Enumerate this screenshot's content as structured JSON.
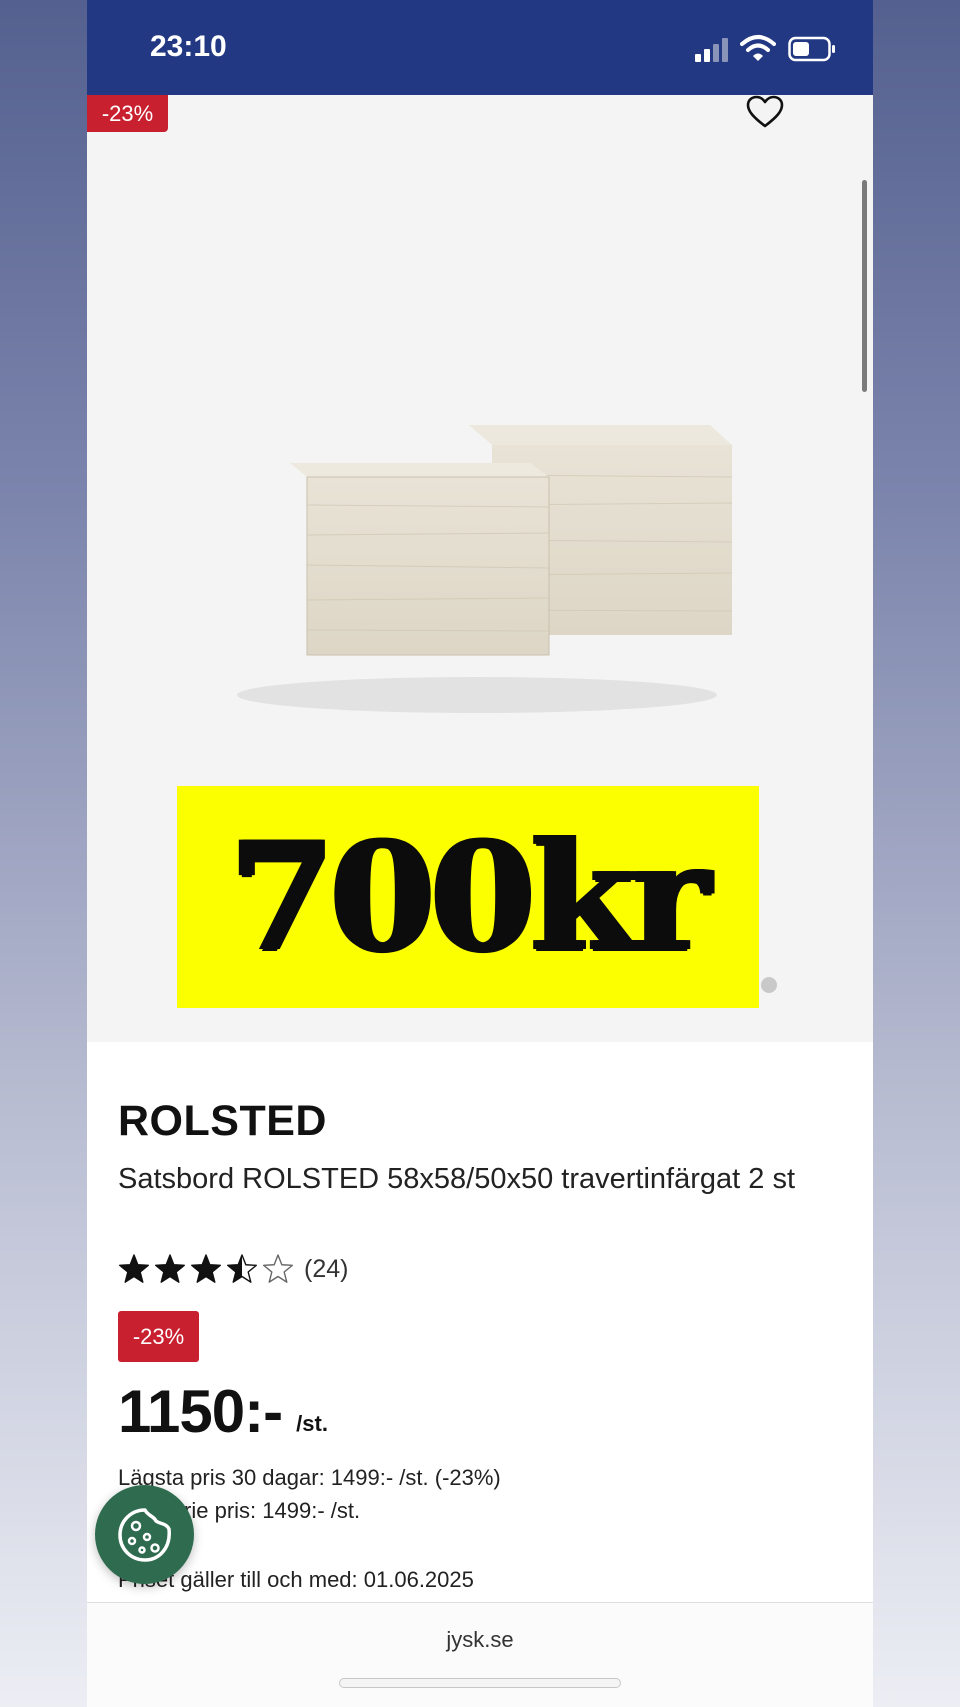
{
  "status_bar": {
    "time": "23:10"
  },
  "gallery": {
    "discount_label": "-23%",
    "promo_text": "700kr",
    "active_slide": 1
  },
  "product": {
    "brand": "ROLSTED",
    "title": "Satsbord ROLSTED 58x58/50x50 travertinfärgat 2 st",
    "rating": 3.5,
    "rating_max": 5,
    "review_count": "(24)",
    "discount_label": "-23%",
    "price": "1150:-",
    "unit": "/st.",
    "lowest_price": "Lägsta pris 30 dagar: 1499:- /st. (-23%)",
    "ordinary_price": "Ordinarie pris: 1499:- /st.",
    "valid_until": "Priset gäller till och med: 01.06.2025"
  },
  "browser": {
    "url": "jysk.se"
  },
  "colors": {
    "status_bar": "#233882",
    "discount": "#c8202f",
    "promo_bg": "#fbff00",
    "cookie_button": "#2e6b4f"
  },
  "icons": [
    "signal-icon",
    "wifi-icon",
    "battery-icon",
    "heart-icon",
    "star-icon",
    "cookie-icon"
  ]
}
